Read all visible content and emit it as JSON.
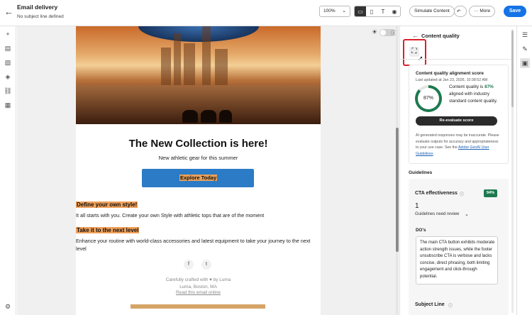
{
  "header": {
    "title": "Email delivery",
    "subtitle": "No subject line defined",
    "zoom": "100%",
    "simulate_label": "Simulate Content",
    "more_label": "More",
    "save_label": "Save",
    "more_icon": "···"
  },
  "canvas": {
    "headline": "The New Collection is here!",
    "headline_sub": "New athletic gear for this summer",
    "cta_label": "Explore Today",
    "section1_title": "Define your own style!",
    "section1_text": "It all starts with you. Create your own Style with athletic tops that are of the moment",
    "section2_title": "Take it to the next level",
    "section2_text": "Enhance your routine with world-class accessories and latest equipment to take your journey to the next level",
    "footer_crafted": "Carefully crafted with ♥ by Luma",
    "footer_address": "Luma, Boston, MA",
    "footer_link": "Read this email online"
  },
  "panel": {
    "title": "Content quality",
    "score_title": "Content quality alignment score",
    "last_updated": "Last updated at Jan 23, 2026, 10:38:52 AM",
    "score": "87%",
    "score_fraction": 0.87,
    "desc_prefix": "Content quality is ",
    "desc_pct": "87%",
    "desc_suffix": "aligned with industry standard content quality.",
    "reevaluate_label": "Re-evaluate score",
    "disclaimer": "AI generated responses may be inaccurate. Please evaluate outputs for accuracy and appropriateness to your use case. See the ",
    "disclaimer_link": "Adobe GenAI User Guidelines",
    "disclaimer_end": ".",
    "guidelines_label": "Guidelines",
    "cta_title": "CTA effectiveness",
    "cta_badge": "94%",
    "cta_count": "1",
    "cta_review": "Guidelines need review",
    "dos_label": "DO's",
    "dos_text": "The main CTA button exhibits moderate action strength issues, while the footer unsubscribe CTA is verbose and lacks concise, direct phrasing, both limiting engagement and click-through potential.",
    "subject_label": "Subject Line"
  },
  "colors": {
    "accent": "#1473e6",
    "score_green": "#1c7a4e",
    "highlight_orange": "#f0a05a",
    "cta_blue": "#2c7bc6",
    "focus_red": "#d9202b"
  }
}
